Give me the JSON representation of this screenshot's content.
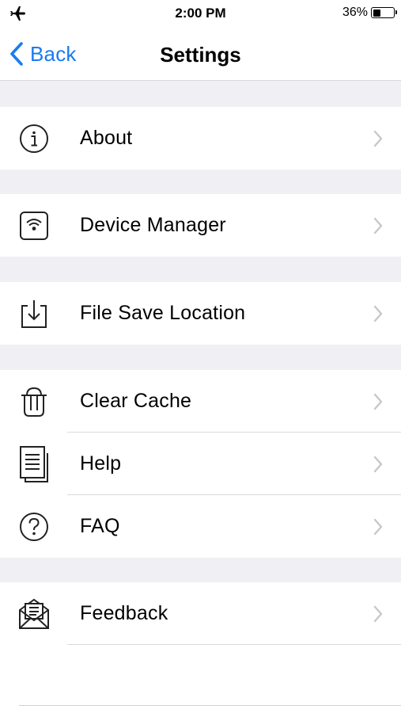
{
  "status_bar": {
    "left_icon": "airplane-icon",
    "time": "2:00 PM",
    "battery_percent_text": "36%",
    "battery_level": 0.36
  },
  "nav": {
    "back_label": "Back",
    "back_icon": "chevron-left-icon",
    "title": "Settings",
    "accent_color": "#1a7bf0"
  },
  "groups": [
    {
      "items": [
        {
          "label": "About",
          "icon": "info-icon"
        }
      ]
    },
    {
      "items": [
        {
          "label": "Device Manager",
          "icon": "wifi-device-icon"
        }
      ]
    },
    {
      "items": [
        {
          "label": "File Save Location",
          "icon": "download-tray-icon"
        }
      ]
    },
    {
      "items": [
        {
          "label": "Clear Cache",
          "icon": "trash-icon"
        },
        {
          "label": "Help",
          "icon": "document-icon"
        },
        {
          "label": "FAQ",
          "icon": "question-icon"
        }
      ]
    },
    {
      "items": [
        {
          "label": "Feedback",
          "icon": "mail-letter-icon"
        }
      ]
    }
  ],
  "colors": {
    "background": "#efeff4",
    "cell": "#ffffff",
    "chevron": "#c7c7cc",
    "separator": "#dadade"
  }
}
